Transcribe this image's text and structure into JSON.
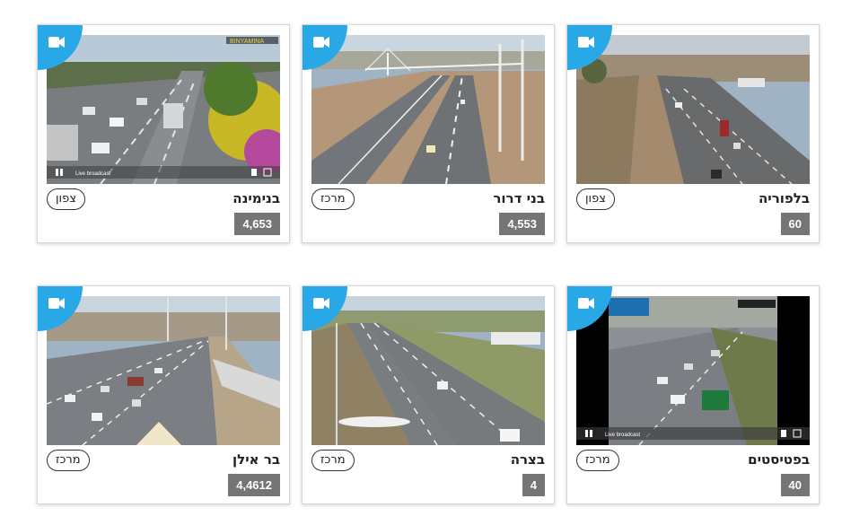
{
  "colors": {
    "accent": "#29a8e8",
    "count_bg": "#757575"
  },
  "icons": {
    "camera": "video-camera-icon"
  },
  "cards": [
    {
      "title": "בנימינה",
      "region": "צפון",
      "count": "4,653",
      "overlay": "Live broadcast",
      "watermark": "BINYAMINA"
    },
    {
      "title": "בני דרור",
      "region": "מרכז",
      "count": "4,553"
    },
    {
      "title": "בלפוריה",
      "region": "צפון",
      "count": "60"
    },
    {
      "title": "בר אילן",
      "region": "מרכז",
      "count": "4,4612"
    },
    {
      "title": "בצרה",
      "region": "מרכז",
      "count": "4"
    },
    {
      "title": "בפטיסטים",
      "region": "מרכז",
      "count": "40",
      "overlay": "Live broadcast"
    }
  ]
}
